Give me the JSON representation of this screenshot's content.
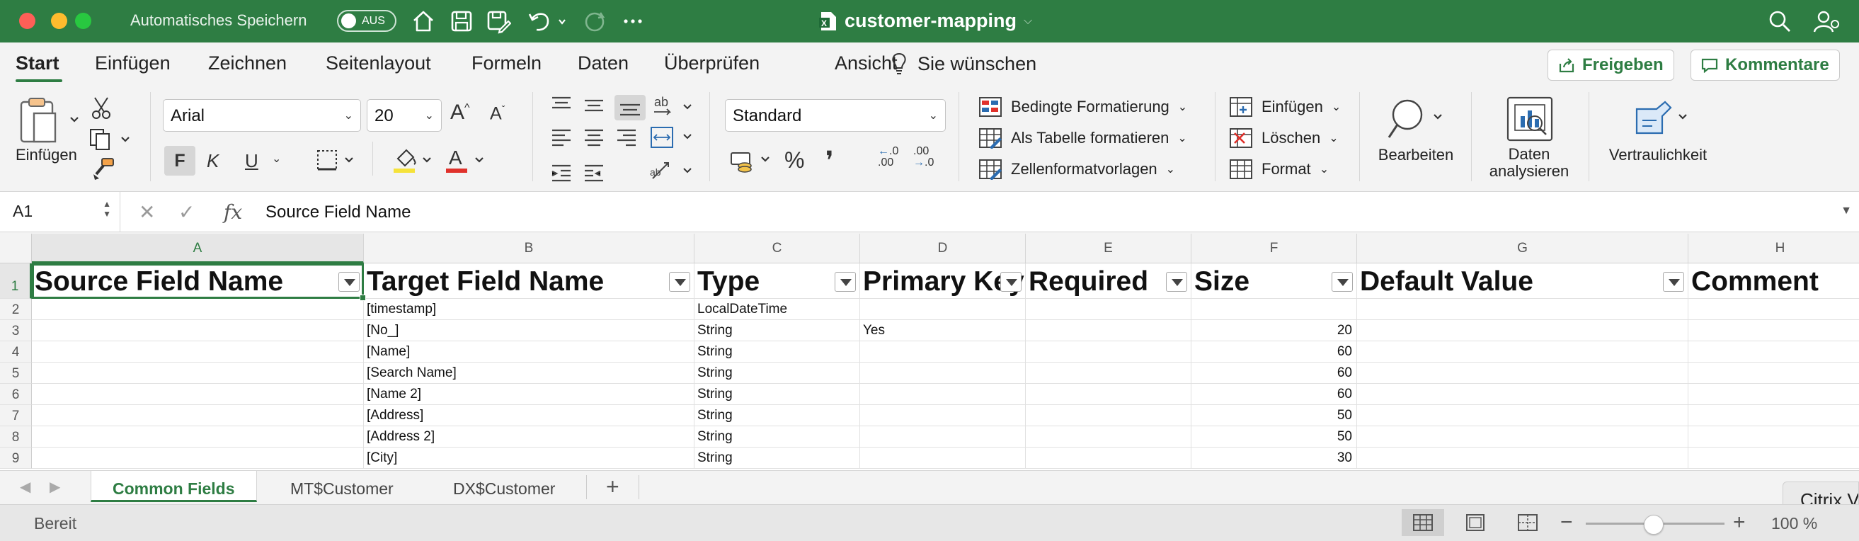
{
  "titlebar": {
    "autosave_label": "Automatisches Speichern",
    "autosave_toggle": "AUS",
    "document_title": "customer-mapping"
  },
  "ribbon_tabs": [
    "Start",
    "Einfügen",
    "Zeichnen",
    "Seitenlayout",
    "Formeln",
    "Daten",
    "Überprüfen",
    "Ansicht"
  ],
  "tell_me": "Sie wünschen",
  "share_button": "Freigeben",
  "comments_button": "Kommentare",
  "ribbon": {
    "paste_label": "Einfügen",
    "font_name": "Arial",
    "font_size": "20",
    "bold": "F",
    "italic": "K",
    "underline": "U",
    "number_format": "Standard",
    "conditional_formatting": "Bedingte Formatierung",
    "format_as_table": "Als Tabelle formatieren",
    "cell_styles": "Zellenformatvorlagen",
    "insert_cells": "Einfügen",
    "delete_cells": "Löschen",
    "format_cells": "Format",
    "edit_label": "Bearbeiten",
    "analyze_label_1": "Daten",
    "analyze_label_2": "analysieren",
    "sensitivity_label": "Vertraulichkeit",
    "percent": "%",
    "comma": "❜",
    "dec_inc": ".00",
    "dec_dec": ".0"
  },
  "formula_bar": {
    "name_box": "A1",
    "fx": "fx",
    "formula": "Source Field Name"
  },
  "columns": [
    "A",
    "B",
    "C",
    "D",
    "E",
    "F",
    "G",
    "H"
  ],
  "rows": [
    "1",
    "2",
    "3",
    "4",
    "5",
    "6",
    "7",
    "8",
    "9"
  ],
  "header_row": [
    "Source Field Name",
    "Target Field Name",
    "Type",
    "Primary Key",
    "Required",
    "Size",
    "Default Value",
    "Comment"
  ],
  "data_rows": [
    [
      "",
      "[timestamp]",
      "LocalDateTime",
      "",
      "",
      "",
      "",
      ""
    ],
    [
      "",
      "[No_]",
      "String",
      "Yes",
      "",
      "20",
      "",
      ""
    ],
    [
      "",
      "[Name]",
      "String",
      "",
      "",
      "60",
      "",
      ""
    ],
    [
      "",
      "[Search Name]",
      "String",
      "",
      "",
      "60",
      "",
      ""
    ],
    [
      "",
      "[Name 2]",
      "String",
      "",
      "",
      "60",
      "",
      ""
    ],
    [
      "",
      "[Address]",
      "String",
      "",
      "",
      "50",
      "",
      ""
    ],
    [
      "",
      "[Address 2]",
      "String",
      "",
      "",
      "50",
      "",
      ""
    ],
    [
      "",
      "[City]",
      "String",
      "",
      "",
      "30",
      "",
      ""
    ]
  ],
  "sheet_tabs": [
    "Common Fields",
    "MT$Customer",
    "DX$Customer"
  ],
  "add_sheet": "+",
  "citrix_label": "Citrix V",
  "status": {
    "state": "Bereit",
    "zoom": "100 %",
    "minus": "−",
    "plus": "+"
  }
}
